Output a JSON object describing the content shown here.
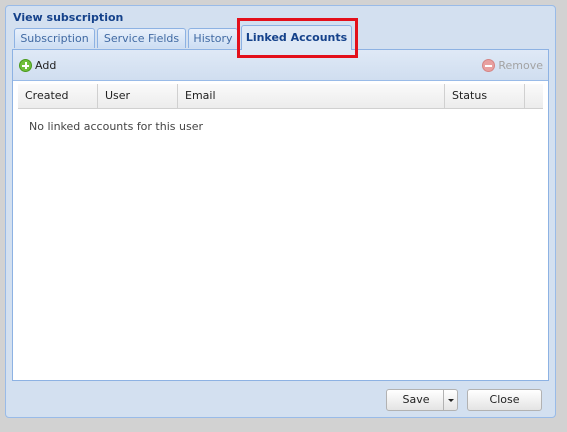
{
  "window": {
    "title": "View subscription"
  },
  "tabs": [
    {
      "label": "Subscription",
      "active": false
    },
    {
      "label": "Service Fields",
      "active": false
    },
    {
      "label": "History",
      "active": false
    },
    {
      "label": "Linked Accounts",
      "active": true
    }
  ],
  "toolbar": {
    "add_label": "Add",
    "remove_label": "Remove"
  },
  "grid": {
    "columns": [
      "Created",
      "User",
      "Email",
      "Status"
    ],
    "empty_text": "No linked accounts for this user"
  },
  "footer": {
    "save_label": "Save",
    "close_label": "Close"
  },
  "colors": {
    "highlight": "#e3101b",
    "title": "#15428b"
  },
  "icons": {
    "add": "add-circle-icon",
    "remove": "remove-circle-icon",
    "save_menu": "chevron-down-icon"
  }
}
